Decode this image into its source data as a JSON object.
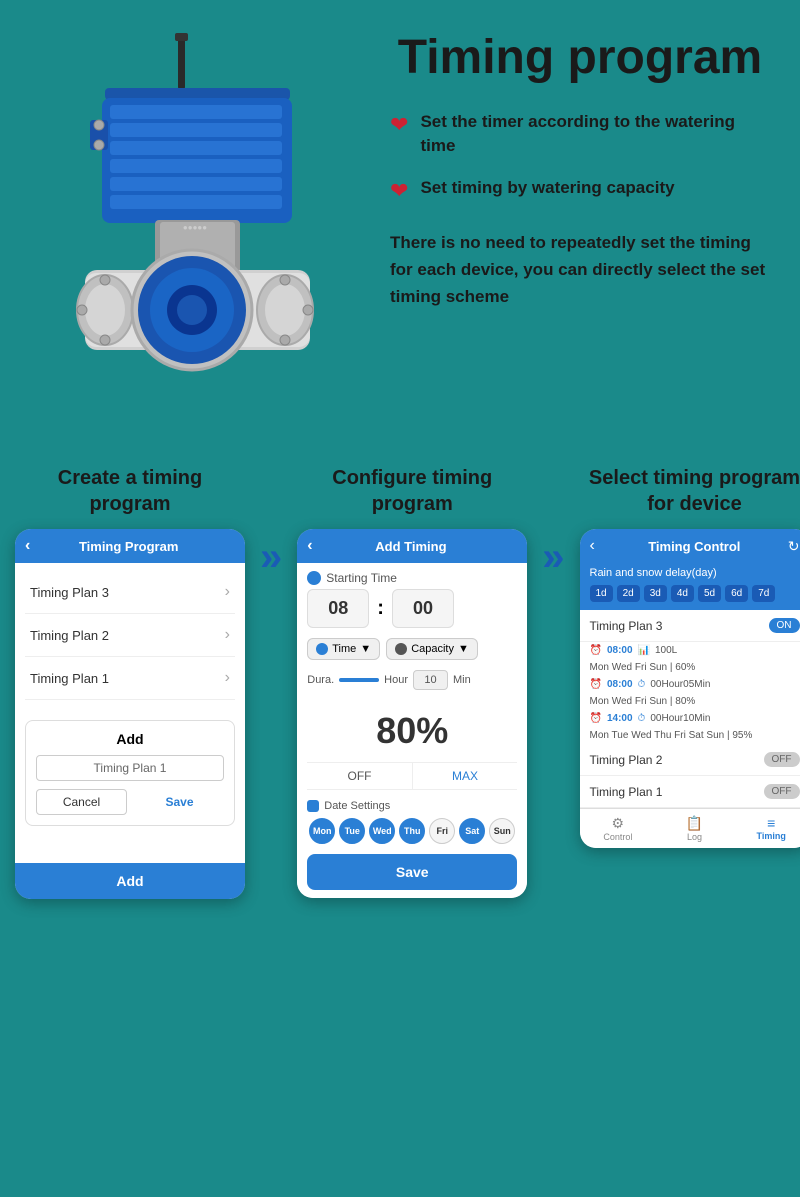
{
  "page": {
    "title": "Timing program",
    "background_color": "#1a8a8a"
  },
  "features": {
    "feature1": "Set the timer according to the watering time",
    "feature2": "Set timing by watering capacity",
    "description": "There is no need to repeatedly set the timing for each device, you can directly select the set timing scheme"
  },
  "column1": {
    "title": "Create a timing program",
    "screen_title": "Timing Program",
    "items": [
      "Timing Plan 3",
      "Timing Plan 2",
      "Timing Plan 1"
    ],
    "dialog_title": "Add",
    "dialog_input": "Timing Plan 1",
    "cancel_label": "Cancel",
    "save_label": "Save",
    "footer_label": "Add"
  },
  "column2": {
    "title": "Configure timing program",
    "screen_title": "Add Timing",
    "starting_time_label": "Starting Time",
    "hour": "08",
    "minute": "00",
    "time_label": "Time",
    "capacity_label": "Capacity",
    "dura_label": "Dura.",
    "hour_label": "Hour",
    "min_value": "10",
    "min_label": "Min",
    "percent": "80%",
    "off_label": "OFF",
    "max_label": "MAX",
    "date_settings_label": "Date Settings",
    "days": [
      {
        "label": "Mon",
        "active": true
      },
      {
        "label": "Tue",
        "active": true
      },
      {
        "label": "Wed",
        "active": true
      },
      {
        "label": "Thu",
        "active": true
      },
      {
        "label": "Fri",
        "active": false
      },
      {
        "label": "Sat",
        "active": true
      },
      {
        "label": "Sun",
        "active": false
      }
    ],
    "save_label": "Save"
  },
  "column3": {
    "title": "Select timing program for device",
    "screen_title": "Timing Control",
    "rain_delay_label": "Rain and snow delay(day)",
    "day_tabs": [
      "1d",
      "2d",
      "3d",
      "4d",
      "5d",
      "6d",
      "7d"
    ],
    "plan3": {
      "name": "Timing Plan 3",
      "toggle": "ON",
      "entries": [
        {
          "time": "08:00",
          "detail": "100L",
          "days": "Mon Wed Fri Sun | 60%"
        },
        {
          "time": "08:00",
          "detail": "00Hour05Min",
          "days": "Mon Wed Fri Sun | 80%"
        },
        {
          "time": "14:00",
          "detail": "00Hour10Min",
          "days": "Mon Tue Wed Thu Fri Sat Sun | 95%"
        }
      ]
    },
    "plan2": {
      "name": "Timing Plan 2",
      "toggle": "OFF"
    },
    "plan1": {
      "name": "Timing Plan 1",
      "toggle": "OFF"
    },
    "footer": {
      "control": "Control",
      "log": "Log",
      "timing": "Timing"
    }
  },
  "arrows": {
    "symbol": "»"
  }
}
